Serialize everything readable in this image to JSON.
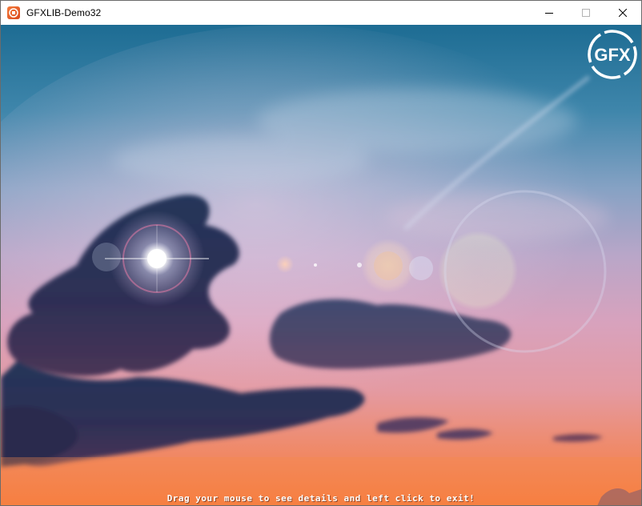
{
  "window": {
    "title": "GFXLIB-Demo32",
    "icon": "app-icon",
    "buttons": [
      "minimize-icon",
      "maximize-icon",
      "close-icon"
    ]
  },
  "canvas": {
    "logo_text": "GFX",
    "status_text": "Drag your mouse to see details and left click to exit!"
  },
  "colors": {
    "sky_top": "#1f6f94",
    "sky_mid": "#9aa6c8",
    "sky_pink": "#d79fbf",
    "horizon": "#f47f4c",
    "cloud_dark": "#2b2f52"
  }
}
